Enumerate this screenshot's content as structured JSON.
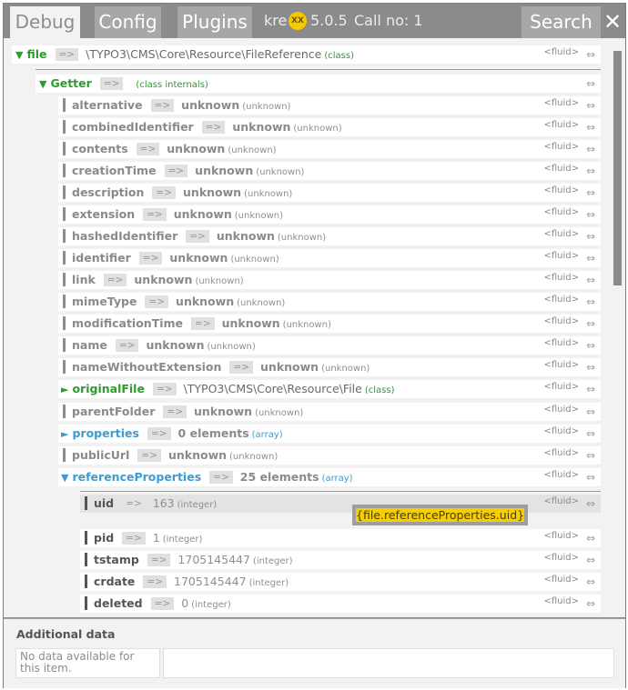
{
  "topbar": {
    "tabs": [
      {
        "label": "Debug",
        "active": true
      },
      {
        "label": "Config",
        "active": false
      },
      {
        "label": "Plugins",
        "active": false
      }
    ],
    "user": "kre",
    "badge": "XX",
    "version": "5.0.5",
    "call": "Call no: 1",
    "search_label": "Search",
    "close_symbol": "✕"
  },
  "tree": {
    "file": {
      "key": "file",
      "arrow": "=>",
      "value": "\\TYPO3\\CMS\\Core\\Resource\\FileReference",
      "type": "(class)",
      "fluid": "<fluid>"
    },
    "getter": {
      "key": "Getter",
      "arrow": "=>",
      "type": "(class internals)"
    },
    "getter_items": [
      {
        "key": "alternative",
        "value": "unknown",
        "type": "(unknown)",
        "fluid": "<fluid>"
      },
      {
        "key": "combinedIdentifier",
        "value": "unknown",
        "type": "(unknown)",
        "fluid": "<fluid>"
      },
      {
        "key": "contents",
        "value": "unknown",
        "type": "(unknown)",
        "fluid": "<fluid>"
      },
      {
        "key": "creationTime",
        "value": "unknown",
        "type": "(unknown)",
        "fluid": "<fluid>"
      },
      {
        "key": "description",
        "value": "unknown",
        "type": "(unknown)",
        "fluid": "<fluid>"
      },
      {
        "key": "extension",
        "value": "unknown",
        "type": "(unknown)",
        "fluid": "<fluid>"
      },
      {
        "key": "hashedIdentifier",
        "value": "unknown",
        "type": "(unknown)",
        "fluid": "<fluid>"
      },
      {
        "key": "identifier",
        "value": "unknown",
        "type": "(unknown)",
        "fluid": "<fluid>"
      },
      {
        "key": "link",
        "value": "unknown",
        "type": "(unknown)",
        "fluid": "<fluid>"
      },
      {
        "key": "mimeType",
        "value": "unknown",
        "type": "(unknown)",
        "fluid": "<fluid>"
      },
      {
        "key": "modificationTime",
        "value": "unknown",
        "type": "(unknown)",
        "fluid": "<fluid>"
      },
      {
        "key": "name",
        "value": "unknown",
        "type": "(unknown)",
        "fluid": "<fluid>"
      },
      {
        "key": "nameWithoutExtension",
        "value": "unknown",
        "type": "(unknown)",
        "fluid": "<fluid>"
      }
    ],
    "original_file": {
      "key": "originalFile",
      "value": "\\TYPO3\\CMS\\Core\\Resource\\File",
      "type": "(class)",
      "fluid": "<fluid>"
    },
    "parent_folder": {
      "key": "parentFolder",
      "value": "unknown",
      "type": "(unknown)",
      "fluid": "<fluid>"
    },
    "properties": {
      "key": "properties",
      "value": "0 elements",
      "type": "(array)",
      "fluid": "<fluid>"
    },
    "public_url": {
      "key": "publicUrl",
      "value": "unknown",
      "type": "(unknown)",
      "fluid": "<fluid>"
    },
    "reference_properties": {
      "key": "referenceProperties",
      "value": "25 elements",
      "type": "(array)",
      "fluid": "<fluid>"
    },
    "ref_items": [
      {
        "key": "uid",
        "value": "163",
        "type": "(integer)",
        "fluid": "<fluid>"
      },
      {
        "key": "pid",
        "value": "1",
        "type": "(integer)",
        "fluid": "<fluid>"
      },
      {
        "key": "tstamp",
        "value": "1705145447",
        "type": "(integer)",
        "fluid": "<fluid>"
      },
      {
        "key": "crdate",
        "value": "1705145447",
        "type": "(integer)",
        "fluid": "<fluid>"
      },
      {
        "key": "deleted",
        "value": "0",
        "type": "(integer)",
        "fluid": "<fluid>"
      }
    ],
    "arrow": "=>",
    "collapse_symbol": "⇔",
    "tooltip": "{file.referenceProperties.uid}"
  },
  "additional": {
    "title": "Additional data",
    "message": "No data available for this item."
  }
}
